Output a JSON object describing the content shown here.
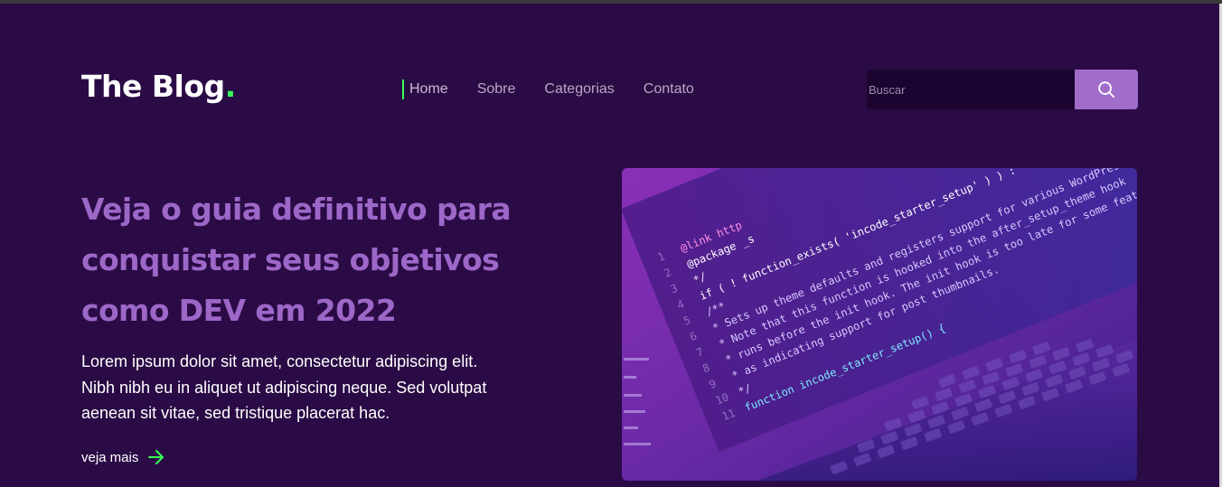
{
  "header": {
    "logo_text": "The Blog",
    "logo_dot": ".",
    "nav": [
      {
        "label": "Home",
        "active": true
      },
      {
        "label": "Sobre",
        "active": false
      },
      {
        "label": "Categorias",
        "active": false
      },
      {
        "label": "Contato",
        "active": false
      }
    ],
    "search": {
      "placeholder": "Buscar",
      "value": "",
      "button_icon": "search-icon"
    }
  },
  "hero": {
    "title": "Veja o guia definitivo para conquistar seus objetivos como DEV em 2022",
    "text": "Lorem ipsum dolor sit amet, consectetur adipiscing elit. Nibh nibh eu in aliquet ut adipiscing neque. Sed volutpat aenean sit vitae, sed tristique placerat hac.",
    "link_label": "veja mais",
    "link_icon": "arrow-right-icon",
    "image_code_lines": [
      "@link http",
      "@package _s",
      "*/",
      "if ( ! function_exists( 'incode_starter_setup' ) ) :",
      "/**",
      " * Sets up theme defaults and registers support for various WordPress",
      " * Note that this function is hooked into the after_setup_theme hook",
      " * runs before the init hook. The init hook is too late for some features",
      " * as indicating support for post thumbnails.",
      " */",
      "function incode_starter_setup() {"
    ]
  },
  "colors": {
    "background": "#2a0b45",
    "accent_green": "#39ff55",
    "accent_purple": "#9d67c8",
    "search_button": "#a06dca"
  }
}
